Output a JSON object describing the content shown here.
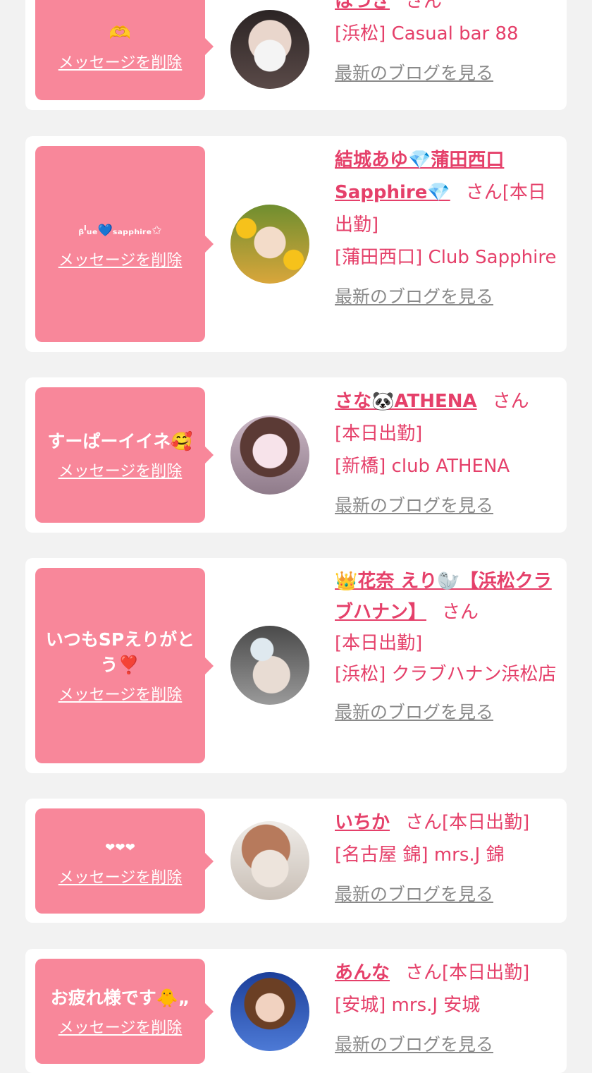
{
  "entries": [
    {
      "message": "🫶",
      "delete_label": "メッセージを削除",
      "name": "はづき",
      "honorific": "さん",
      "status": "",
      "shop": "[浜松] Casual bar 88",
      "blog_label": "最新のブログを見る"
    },
    {
      "message": "ᵦˡᵤₑ💙ₛₐₚₚₕᵢᵣₑ✩",
      "delete_label": "メッセージを削除",
      "name": "結城あゆ💎蒲田西口Sapphire💎",
      "honorific": "さん",
      "status": "[本日出勤]",
      "shop": "[蒲田西口] Club Sapphire",
      "blog_label": "最新のブログを見る"
    },
    {
      "message": "すーぱーイイネ🥰",
      "delete_label": "メッセージを削除",
      "name": "さな🐼ATHENA",
      "honorific": "さん",
      "status": "[本日出勤]",
      "shop": "[新橋] club ATHENA",
      "blog_label": "最新のブログを見る"
    },
    {
      "message": "いつもSPえりがとう❣️",
      "delete_label": "メッセージを削除",
      "name": "👑花奈 えり🦭【浜松クラブハナン】",
      "honorific": "さん",
      "status": "[本日出勤]",
      "shop": "[浜松] クラブハナン浜松店",
      "blog_label": "最新のブログを見る"
    },
    {
      "message": "❤︎❤︎❤︎",
      "delete_label": "メッセージを削除",
      "name": "いちか",
      "honorific": "さん",
      "status": "[本日出勤]",
      "shop": "[名古屋 錦] mrs.J 錦",
      "blog_label": "最新のブログを見る"
    },
    {
      "message": "お疲れ様です🐥„",
      "delete_label": "メッセージを削除",
      "name": "あんな",
      "honorific": "さん",
      "status": "[本日出勤]",
      "shop": "[安城] mrs.J 安城",
      "blog_label": "最新のブログを見る"
    }
  ]
}
